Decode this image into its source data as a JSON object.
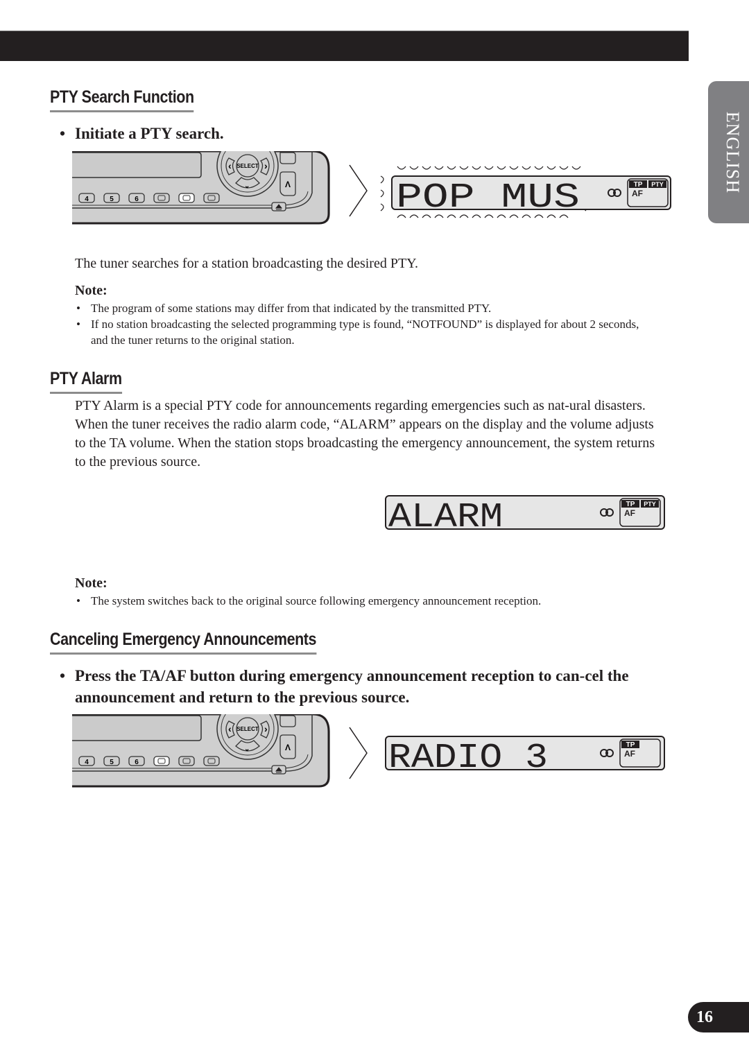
{
  "side_tab": {
    "label": "ENGLISH"
  },
  "sections": {
    "pty_search": {
      "title": "PTY Search Function",
      "step": "Initiate a PTY search.",
      "bullet": "•",
      "lcd_text": "POP MUS",
      "description": "The tuner searches for a station broadcasting the desired PTY.",
      "note_label": "Note:",
      "notes": [
        "The program of some stations may differ from that indicated by the transmitted PTY.",
        "If no station broadcasting the selected programming type is found, “NOTFOUND” is displayed for about 2 seconds, and the tuner returns to the original station."
      ]
    },
    "pty_alarm": {
      "title": "PTY Alarm",
      "description": "PTY Alarm is a special PTY code for announcements regarding emergencies such as nat-ural disasters. When the tuner receives the radio alarm code, “ALARM” appears on the display and the volume adjusts to the TA volume. When the station stops broadcasting the emergency announcement, the system returns to the previous source.",
      "lcd_text": "ALARM",
      "note_label": "Note:",
      "notes": [
        "The system switches back to the original source following emergency announcement reception."
      ]
    },
    "cancel": {
      "title": "Canceling Emergency Announcements",
      "bullet": "•",
      "step": "Press the TA/AF button during emergency announcement reception to can-cel the announcement and return to the previous source.",
      "lcd_text": "RADIO 3"
    }
  },
  "device": {
    "preset_buttons": [
      "4",
      "5",
      "6",
      "",
      "",
      ""
    ],
    "select_label": "SELECT",
    "up_label": "Λ"
  },
  "lcd_indicators": {
    "tp": "TP",
    "pty": "PTY",
    "af": "AF"
  },
  "page_number": "16"
}
